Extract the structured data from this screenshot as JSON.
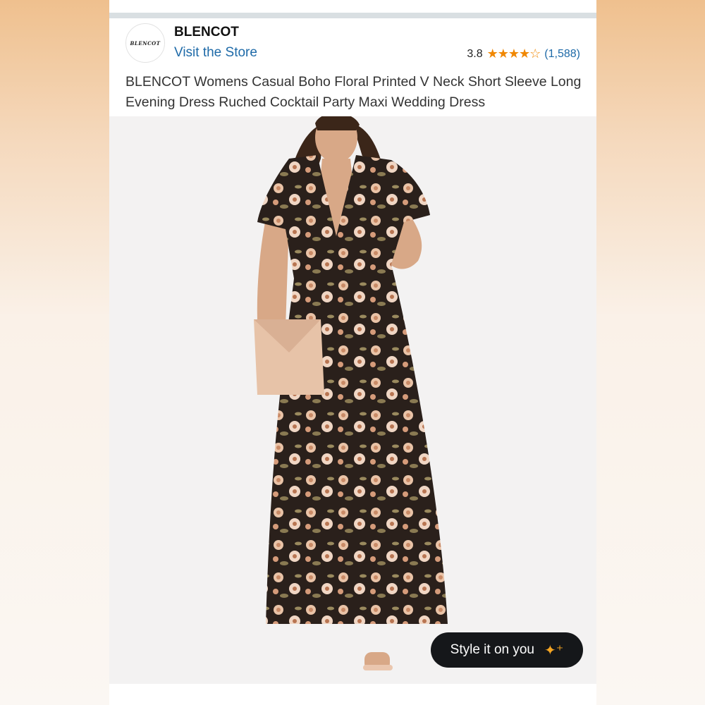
{
  "store": {
    "logo_text": "BLENCOT",
    "brand_name": "BLENCOT",
    "visit_link": "Visit the Store"
  },
  "rating": {
    "value": "3.8",
    "stars_filled": 3.8,
    "stars_total": 5,
    "count": "(1,588)"
  },
  "product": {
    "title": "BLENCOT Womens Casual Boho Floral Printed V Neck Short Sleeve Long Evening Dress Ruched Cocktail Party Maxi Wedding Dress",
    "image_alt": "woman-in-floral-maxi-dress"
  },
  "actions": {
    "style_button": "Style it on you",
    "style_icon": "sparkle-icon"
  },
  "colors": {
    "link": "#1e6aa8",
    "star": "#f08804",
    "button_bg": "#15171a"
  }
}
